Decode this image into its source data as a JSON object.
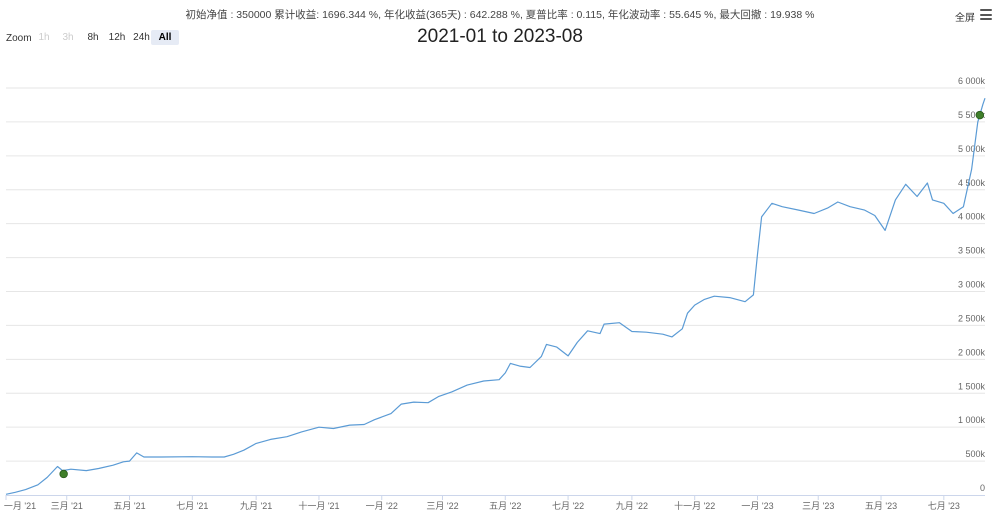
{
  "header": {
    "stats_text": "初始净值 : 350000 累计收益: 1696.344 %, 年化收益(365天) : 642.288 %, 夏普比率 : 0.115, 年化波动率 : 55.645 %, 最大回撤 : 19.938 %",
    "fullscreen_label": "全屏"
  },
  "zoom": {
    "label": "Zoom",
    "buttons": [
      {
        "label": "1h",
        "state": "disabled"
      },
      {
        "label": "3h",
        "state": "disabled"
      },
      {
        "label": "8h",
        "state": "normal"
      },
      {
        "label": "12h",
        "state": "normal"
      },
      {
        "label": "24h",
        "state": "normal"
      },
      {
        "label": "All",
        "state": "active"
      }
    ]
  },
  "colors": {
    "line": "#5b9bd5",
    "grid": "#e6e6e6",
    "axis": "#ccd6eb",
    "marker": "#3f7f2a"
  },
  "chart_data": {
    "type": "line",
    "title": "2021-01 to 2023-08",
    "x_start": "2021-01-01",
    "x_end": "2023-08-10",
    "xlim": [
      "2021-01-01",
      "2023-08-10"
    ],
    "ylim": [
      0,
      6000000
    ],
    "x_ticks": [
      {
        "date": "2021-01-01",
        "label": "一月 '21"
      },
      {
        "date": "2021-03-01",
        "label": "三月 '21"
      },
      {
        "date": "2021-05-01",
        "label": "五月 '21"
      },
      {
        "date": "2021-07-01",
        "label": "七月 '21"
      },
      {
        "date": "2021-09-01",
        "label": "九月 '21"
      },
      {
        "date": "2021-11-01",
        "label": "十一月 '21"
      },
      {
        "date": "2022-01-01",
        "label": "一月 '22"
      },
      {
        "date": "2022-03-01",
        "label": "三月 '22"
      },
      {
        "date": "2022-05-01",
        "label": "五月 '22"
      },
      {
        "date": "2022-07-01",
        "label": "七月 '22"
      },
      {
        "date": "2022-09-01",
        "label": "九月 '22"
      },
      {
        "date": "2022-11-01",
        "label": "十一月 '22"
      },
      {
        "date": "2023-01-01",
        "label": "一月 '23"
      },
      {
        "date": "2023-03-01",
        "label": "三月 '23"
      },
      {
        "date": "2023-05-01",
        "label": "五月 '23"
      },
      {
        "date": "2023-07-01",
        "label": "七月 '23"
      }
    ],
    "y_ticks": [
      {
        "value": 0,
        "label": "0"
      },
      {
        "value": 500000,
        "label": "500k"
      },
      {
        "value": 1000000,
        "label": "1 000k"
      },
      {
        "value": 1500000,
        "label": "1 500k"
      },
      {
        "value": 2000000,
        "label": "2 000k"
      },
      {
        "value": 2500000,
        "label": "2 500k"
      },
      {
        "value": 3000000,
        "label": "3 000k"
      },
      {
        "value": 3500000,
        "label": "3 500k"
      },
      {
        "value": 4000000,
        "label": "4 000k"
      },
      {
        "value": 4500000,
        "label": "4 500k"
      },
      {
        "value": 5000000,
        "label": "5 000k"
      },
      {
        "value": 5500000,
        "label": "5 500k"
      },
      {
        "value": 6000000,
        "label": "6 000k"
      }
    ],
    "grid": true,
    "series": [
      {
        "points": [
          [
            "2021-01-01",
            10000
          ],
          [
            "2021-01-10",
            40000
          ],
          [
            "2021-01-20",
            80000
          ],
          [
            "2021-02-01",
            150000
          ],
          [
            "2021-02-10",
            260000
          ],
          [
            "2021-02-20",
            420000
          ],
          [
            "2021-02-25",
            360000
          ],
          [
            "2021-03-05",
            380000
          ],
          [
            "2021-03-20",
            360000
          ],
          [
            "2021-04-01",
            390000
          ],
          [
            "2021-04-15",
            440000
          ],
          [
            "2021-04-25",
            490000
          ],
          [
            "2021-05-01",
            500000
          ],
          [
            "2021-05-08",
            620000
          ],
          [
            "2021-05-15",
            560000
          ],
          [
            "2021-06-01",
            560000
          ],
          [
            "2021-07-01",
            565000
          ],
          [
            "2021-07-20",
            560000
          ],
          [
            "2021-08-01",
            560000
          ],
          [
            "2021-08-10",
            600000
          ],
          [
            "2021-08-20",
            660000
          ],
          [
            "2021-09-01",
            760000
          ],
          [
            "2021-09-15",
            820000
          ],
          [
            "2021-10-01",
            860000
          ],
          [
            "2021-10-15",
            930000
          ],
          [
            "2021-11-01",
            1000000
          ],
          [
            "2021-11-15",
            980000
          ],
          [
            "2021-12-01",
            1030000
          ],
          [
            "2021-12-15",
            1040000
          ],
          [
            "2021-12-25",
            1110000
          ],
          [
            "2022-01-10",
            1200000
          ],
          [
            "2022-01-20",
            1340000
          ],
          [
            "2022-02-01",
            1370000
          ],
          [
            "2022-02-15",
            1360000
          ],
          [
            "2022-02-25",
            1450000
          ],
          [
            "2022-03-10",
            1520000
          ],
          [
            "2022-03-25",
            1620000
          ],
          [
            "2022-04-10",
            1680000
          ],
          [
            "2022-04-25",
            1700000
          ],
          [
            "2022-05-01",
            1800000
          ],
          [
            "2022-05-06",
            1940000
          ],
          [
            "2022-05-15",
            1900000
          ],
          [
            "2022-05-25",
            1880000
          ],
          [
            "2022-06-05",
            2040000
          ],
          [
            "2022-06-10",
            2220000
          ],
          [
            "2022-06-20",
            2180000
          ],
          [
            "2022-07-01",
            2050000
          ],
          [
            "2022-07-10",
            2250000
          ],
          [
            "2022-07-20",
            2420000
          ],
          [
            "2022-08-01",
            2380000
          ],
          [
            "2022-08-05",
            2520000
          ],
          [
            "2022-08-20",
            2540000
          ],
          [
            "2022-09-01",
            2410000
          ],
          [
            "2022-09-15",
            2400000
          ],
          [
            "2022-10-01",
            2370000
          ],
          [
            "2022-10-10",
            2330000
          ],
          [
            "2022-10-20",
            2450000
          ],
          [
            "2022-10-25",
            2680000
          ],
          [
            "2022-11-01",
            2800000
          ],
          [
            "2022-11-10",
            2880000
          ],
          [
            "2022-11-20",
            2930000
          ],
          [
            "2022-12-05",
            2910000
          ],
          [
            "2022-12-20",
            2850000
          ],
          [
            "2022-12-28",
            2950000
          ],
          [
            "2023-01-01",
            3550000
          ],
          [
            "2023-01-05",
            4100000
          ],
          [
            "2023-01-15",
            4300000
          ],
          [
            "2023-01-25",
            4250000
          ],
          [
            "2023-02-10",
            4200000
          ],
          [
            "2023-02-25",
            4150000
          ],
          [
            "2023-03-10",
            4230000
          ],
          [
            "2023-03-20",
            4320000
          ],
          [
            "2023-04-01",
            4250000
          ],
          [
            "2023-04-15",
            4200000
          ],
          [
            "2023-04-25",
            4120000
          ],
          [
            "2023-05-05",
            3900000
          ],
          [
            "2023-05-15",
            4350000
          ],
          [
            "2023-05-25",
            4580000
          ],
          [
            "2023-06-05",
            4400000
          ],
          [
            "2023-06-15",
            4600000
          ],
          [
            "2023-06-20",
            4350000
          ],
          [
            "2023-07-01",
            4300000
          ],
          [
            "2023-07-10",
            4150000
          ],
          [
            "2023-07-20",
            4250000
          ],
          [
            "2023-07-28",
            4800000
          ],
          [
            "2023-08-03",
            5500000
          ],
          [
            "2023-08-08",
            5760000
          ],
          [
            "2023-08-10",
            5850000
          ]
        ]
      }
    ],
    "markers": [
      {
        "x": "2021-02-26",
        "y": 310000
      },
      {
        "x": "2023-08-05",
        "y": 5600000
      }
    ]
  }
}
